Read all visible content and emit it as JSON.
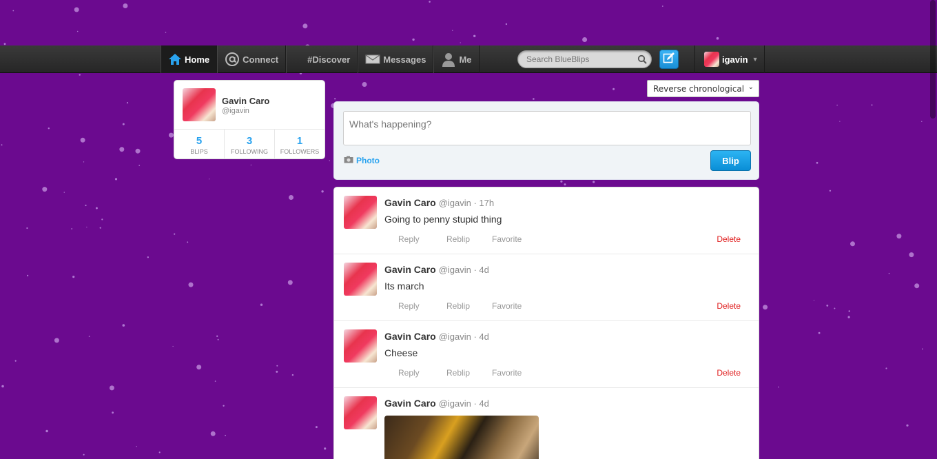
{
  "theme": {
    "background": "#6b0a8f",
    "accent": "#2aa3ef",
    "delete_color": "#e02020"
  },
  "nav": {
    "items": [
      {
        "label": "Home",
        "icon": "home-icon",
        "active": true
      },
      {
        "label": "Connect",
        "icon": "at-icon",
        "active": false
      },
      {
        "label": "#Discover",
        "icon": "",
        "active": false
      },
      {
        "label": "Messages",
        "icon": "envelope-icon",
        "active": false
      },
      {
        "label": "Me",
        "icon": "person-icon",
        "active": false
      }
    ]
  },
  "search": {
    "placeholder": "Search BlueBlips"
  },
  "user_menu": {
    "username": "igavin"
  },
  "profile": {
    "name": "Gavin Caro",
    "handle": "@igavin",
    "stats": [
      {
        "value": "5",
        "label": "BLIPS"
      },
      {
        "value": "3",
        "label": "FOLLOWING"
      },
      {
        "value": "1",
        "label": "FOLLOWERS"
      }
    ]
  },
  "sort": {
    "selected": "Reverse chronological"
  },
  "composer": {
    "placeholder": "What's happening?",
    "photo_label": "Photo",
    "submit_label": "Blip"
  },
  "actions": {
    "reply": "Reply",
    "reblip": "Reblip",
    "favorite": "Favorite",
    "delete": "Delete"
  },
  "blips": [
    {
      "name": "Gavin Caro",
      "meta": "@igavin · 17h",
      "text": "Going to penny stupid thing"
    },
    {
      "name": "Gavin Caro",
      "meta": "@igavin · 4d",
      "text": "Its march"
    },
    {
      "name": "Gavin Caro",
      "meta": "@igavin · 4d",
      "text": "Cheese"
    },
    {
      "name": "Gavin Caro",
      "meta": "@igavin · 4d",
      "text": ""
    }
  ]
}
